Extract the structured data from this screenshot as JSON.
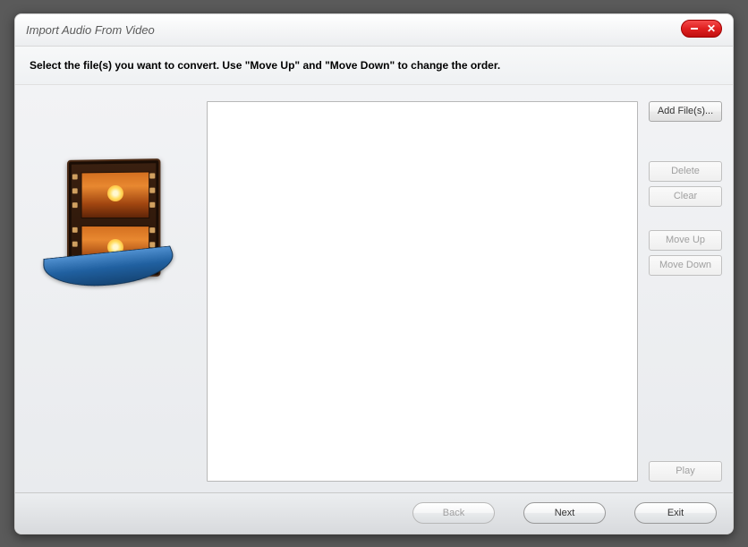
{
  "window": {
    "title": "Import Audio From Video"
  },
  "instruction": "Select the file(s) you want to convert. Use \"Move Up\" and \"Move Down\" to change the order.",
  "side_buttons": {
    "add": "Add File(s)...",
    "delete": "Delete",
    "clear": "Clear",
    "move_up": "Move Up",
    "move_down": "Move Down",
    "play": "Play"
  },
  "footer": {
    "back": "Back",
    "next": "Next",
    "exit": "Exit"
  }
}
